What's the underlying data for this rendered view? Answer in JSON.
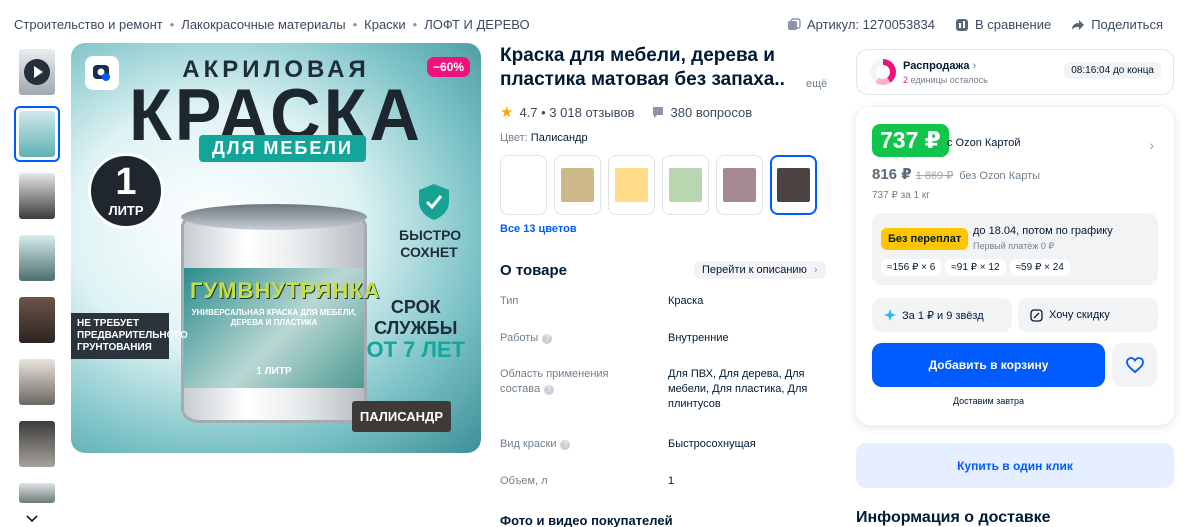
{
  "breadcrumbs": [
    "Строительство и ремонт",
    "Лакокрасочные материалы",
    "Краски",
    "ЛОФТ И ДЕРЕВО"
  ],
  "top_actions": {
    "article": "Артикул: 1270053834",
    "compare": "В сравнение",
    "share": "Поделиться"
  },
  "image": {
    "discount": "−60%",
    "headline_small": "АКРИЛОВАЯ",
    "headline_big": "КРАСКА",
    "headline_ribbon": "ДЛЯ МЕБЕЛИ",
    "volume_number": "1",
    "volume_unit": "ЛИТР",
    "brand": "ГУМВНУТРЯНКА",
    "brand_sub": "УНИВЕРСАЛЬНАЯ КРАСКА ДЛЯ МЕБЕЛИ, ДЕРЕВА И ПЛАСТИКА",
    "can_volume": "1 ЛИТР",
    "quick_dry": "БЫСТРО СОХНЕТ",
    "life_line1": "СРОК",
    "life_line2": "СЛУЖБЫ",
    "life_line3": "ОТ 7 ЛЕТ",
    "no_primer": "НЕ ТРЕБУЕТ ПРЕДВАРИТЕЛЬНОГО ГРУНТОВАНИЯ",
    "color_tag": "ПАЛИСАНДР"
  },
  "product": {
    "title": "Краска для мебели, дерева и пластика матовая без запаха..",
    "more": "ещё",
    "rating": "4.7 • 3 018 отзывов",
    "questions": "380 вопросов",
    "color_label": "Цвет:",
    "color_value": "Палисандр",
    "all_colors": "Все 13 цветов",
    "swatches": [
      "#ffffff",
      "#cdb88a",
      "#ffdd88",
      "#b8d6b0",
      "#a48990",
      "#4a4342"
    ]
  },
  "about": {
    "title": "О товаре",
    "go_to_description": "Перейти к описанию",
    "attributes": [
      {
        "label": "Тип",
        "value": "Краска"
      },
      {
        "label": "Работы",
        "value": "Внутренние"
      },
      {
        "label": "Область применения состава",
        "value": "Для ПВХ, Для дерева, Для мебели, Для пластика, Для плинтусов"
      },
      {
        "label": "Вид краски",
        "value": "Быстросохнущая"
      },
      {
        "label": "Объем, л",
        "value": "1"
      }
    ],
    "photos_title": "Фото и видео покупателей"
  },
  "sale": {
    "title": "Распродажа",
    "remaining_count": "2",
    "remaining_text": "единицы осталось",
    "timer": "08:16:04 до конца"
  },
  "price": {
    "ozon_card_price": "737 ₽",
    "ozon_card_label": "с Ozon Картой",
    "regular": "816 ₽",
    "old": "1 869 ₽",
    "regular_label": "без Ozon Карты",
    "per_unit": "737 ₽ за 1 кг",
    "installment_tag": "Без переплат",
    "installment_line1": "до 18.04, потом по графику",
    "installment_line2": "Первый платёж 0 ₽",
    "installment_chips": [
      "≈156 ₽ × 6",
      "≈91 ₽ × 12",
      "≈59 ₽ × 24"
    ],
    "bonus_stars": "За 1 ₽ и 9 звёзд",
    "want_discount": "Хочу скидку",
    "add_to_cart": "Добавить в корзину",
    "delivery": "Доставим завтра",
    "one_click": "Купить в один клик"
  },
  "delivery_title": "Информация о доставке",
  "colors": {
    "accent": "#005bff",
    "price_green": "#10c44c",
    "sale_pink": "#f1117e",
    "installment_yellow": "#ffc600"
  }
}
